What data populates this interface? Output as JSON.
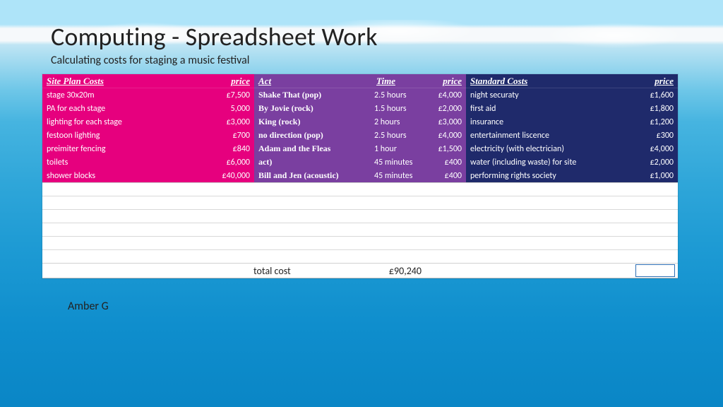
{
  "title": "Computing - Spreadsheet Work",
  "subtitle": "Calculating costs for staging a music festival",
  "author": "Amber G",
  "blocks": {
    "siteplan": {
      "header_left": "Site Plan Costs",
      "header_right": "price",
      "rows": [
        {
          "item": "stage 30x20m",
          "price": "£7,500"
        },
        {
          "item": "PA for each stage",
          "price": "5,000"
        },
        {
          "item": "lighting for each stage",
          "price": "£3,000"
        },
        {
          "item": "festoon lighting",
          "price": "£700"
        },
        {
          "item": "preimiter fencing",
          "price": "£840"
        },
        {
          "item": "toilets",
          "price": "£6,000"
        },
        {
          "item": "shower blocks",
          "price": "£40,000"
        }
      ]
    },
    "acts": {
      "header_left": "Act",
      "header_mid": "Time",
      "header_right": "price",
      "rows": [
        {
          "item": "Shake That (pop)",
          "mid": "2.5 hours",
          "price": "£4,000"
        },
        {
          "item": "By Jovie (rock)",
          "mid": "1.5 hours",
          "price": "£2,000"
        },
        {
          "item": "King (rock)",
          "mid": "2 hours",
          "price": "£3,000"
        },
        {
          "item": "no direction (pop)",
          "mid": "2.5 hours",
          "price": "£4,000"
        },
        {
          "item": "Adam and the Fleas",
          "mid": "1 hour",
          "price": "£1,500"
        },
        {
          "item": "act)",
          "mid": "45 minutes",
          "price": "£400"
        },
        {
          "item": "Bill and Jen (acoustic)",
          "mid": "45 minutes",
          "price": "£400"
        }
      ]
    },
    "standard": {
      "header_left": "Standard Costs",
      "header_right": "price",
      "rows": [
        {
          "item": "night securaty",
          "price": "£1,600"
        },
        {
          "item": "first aid",
          "price": "£1,800"
        },
        {
          "item": "insurance",
          "price": "£1,200"
        },
        {
          "item": "entertainment liscence",
          "price": "£300"
        },
        {
          "item": "electricity (with electrician)",
          "price": "£4,000"
        },
        {
          "item": "water (including waste) for site",
          "price": "£2,000"
        },
        {
          "item": "performing  rights society",
          "price": "£1,000"
        }
      ]
    }
  },
  "total": {
    "label": "total cost",
    "value": "£90,240"
  },
  "chart_data": {
    "type": "table",
    "title": "Calculating costs for staging a music festival",
    "tables": [
      {
        "name": "Site Plan Costs",
        "columns": [
          "item",
          "price_gbp"
        ],
        "rows": [
          [
            "stage 30x20m",
            7500
          ],
          [
            "PA for each stage",
            5000
          ],
          [
            "lighting for each stage",
            3000
          ],
          [
            "festoon lighting",
            700
          ],
          [
            "preimiter fencing",
            840
          ],
          [
            "toilets",
            6000
          ],
          [
            "shower blocks",
            40000
          ]
        ]
      },
      {
        "name": "Acts",
        "columns": [
          "act",
          "time",
          "price_gbp"
        ],
        "rows": [
          [
            "Shake That (pop)",
            "2.5 hours",
            4000
          ],
          [
            "By Jovie (rock)",
            "1.5 hours",
            2000
          ],
          [
            "King (rock)",
            "2 hours",
            3000
          ],
          [
            "no direction (pop)",
            "2.5 hours",
            4000
          ],
          [
            "Adam and the Fleas",
            "1 hour",
            1500
          ],
          [
            "act)",
            "45 minutes",
            400
          ],
          [
            "Bill and Jen (acoustic)",
            "45 minutes",
            400
          ]
        ]
      },
      {
        "name": "Standard Costs",
        "columns": [
          "item",
          "price_gbp"
        ],
        "rows": [
          [
            "night securaty",
            1600
          ],
          [
            "first aid",
            1800
          ],
          [
            "insurance",
            1200
          ],
          [
            "entertainment liscence",
            300
          ],
          [
            "electricity (with electrician)",
            4000
          ],
          [
            "water (including waste) for site",
            2000
          ],
          [
            "performing  rights society",
            1000
          ]
        ]
      }
    ],
    "total_cost_gbp": 90240
  }
}
